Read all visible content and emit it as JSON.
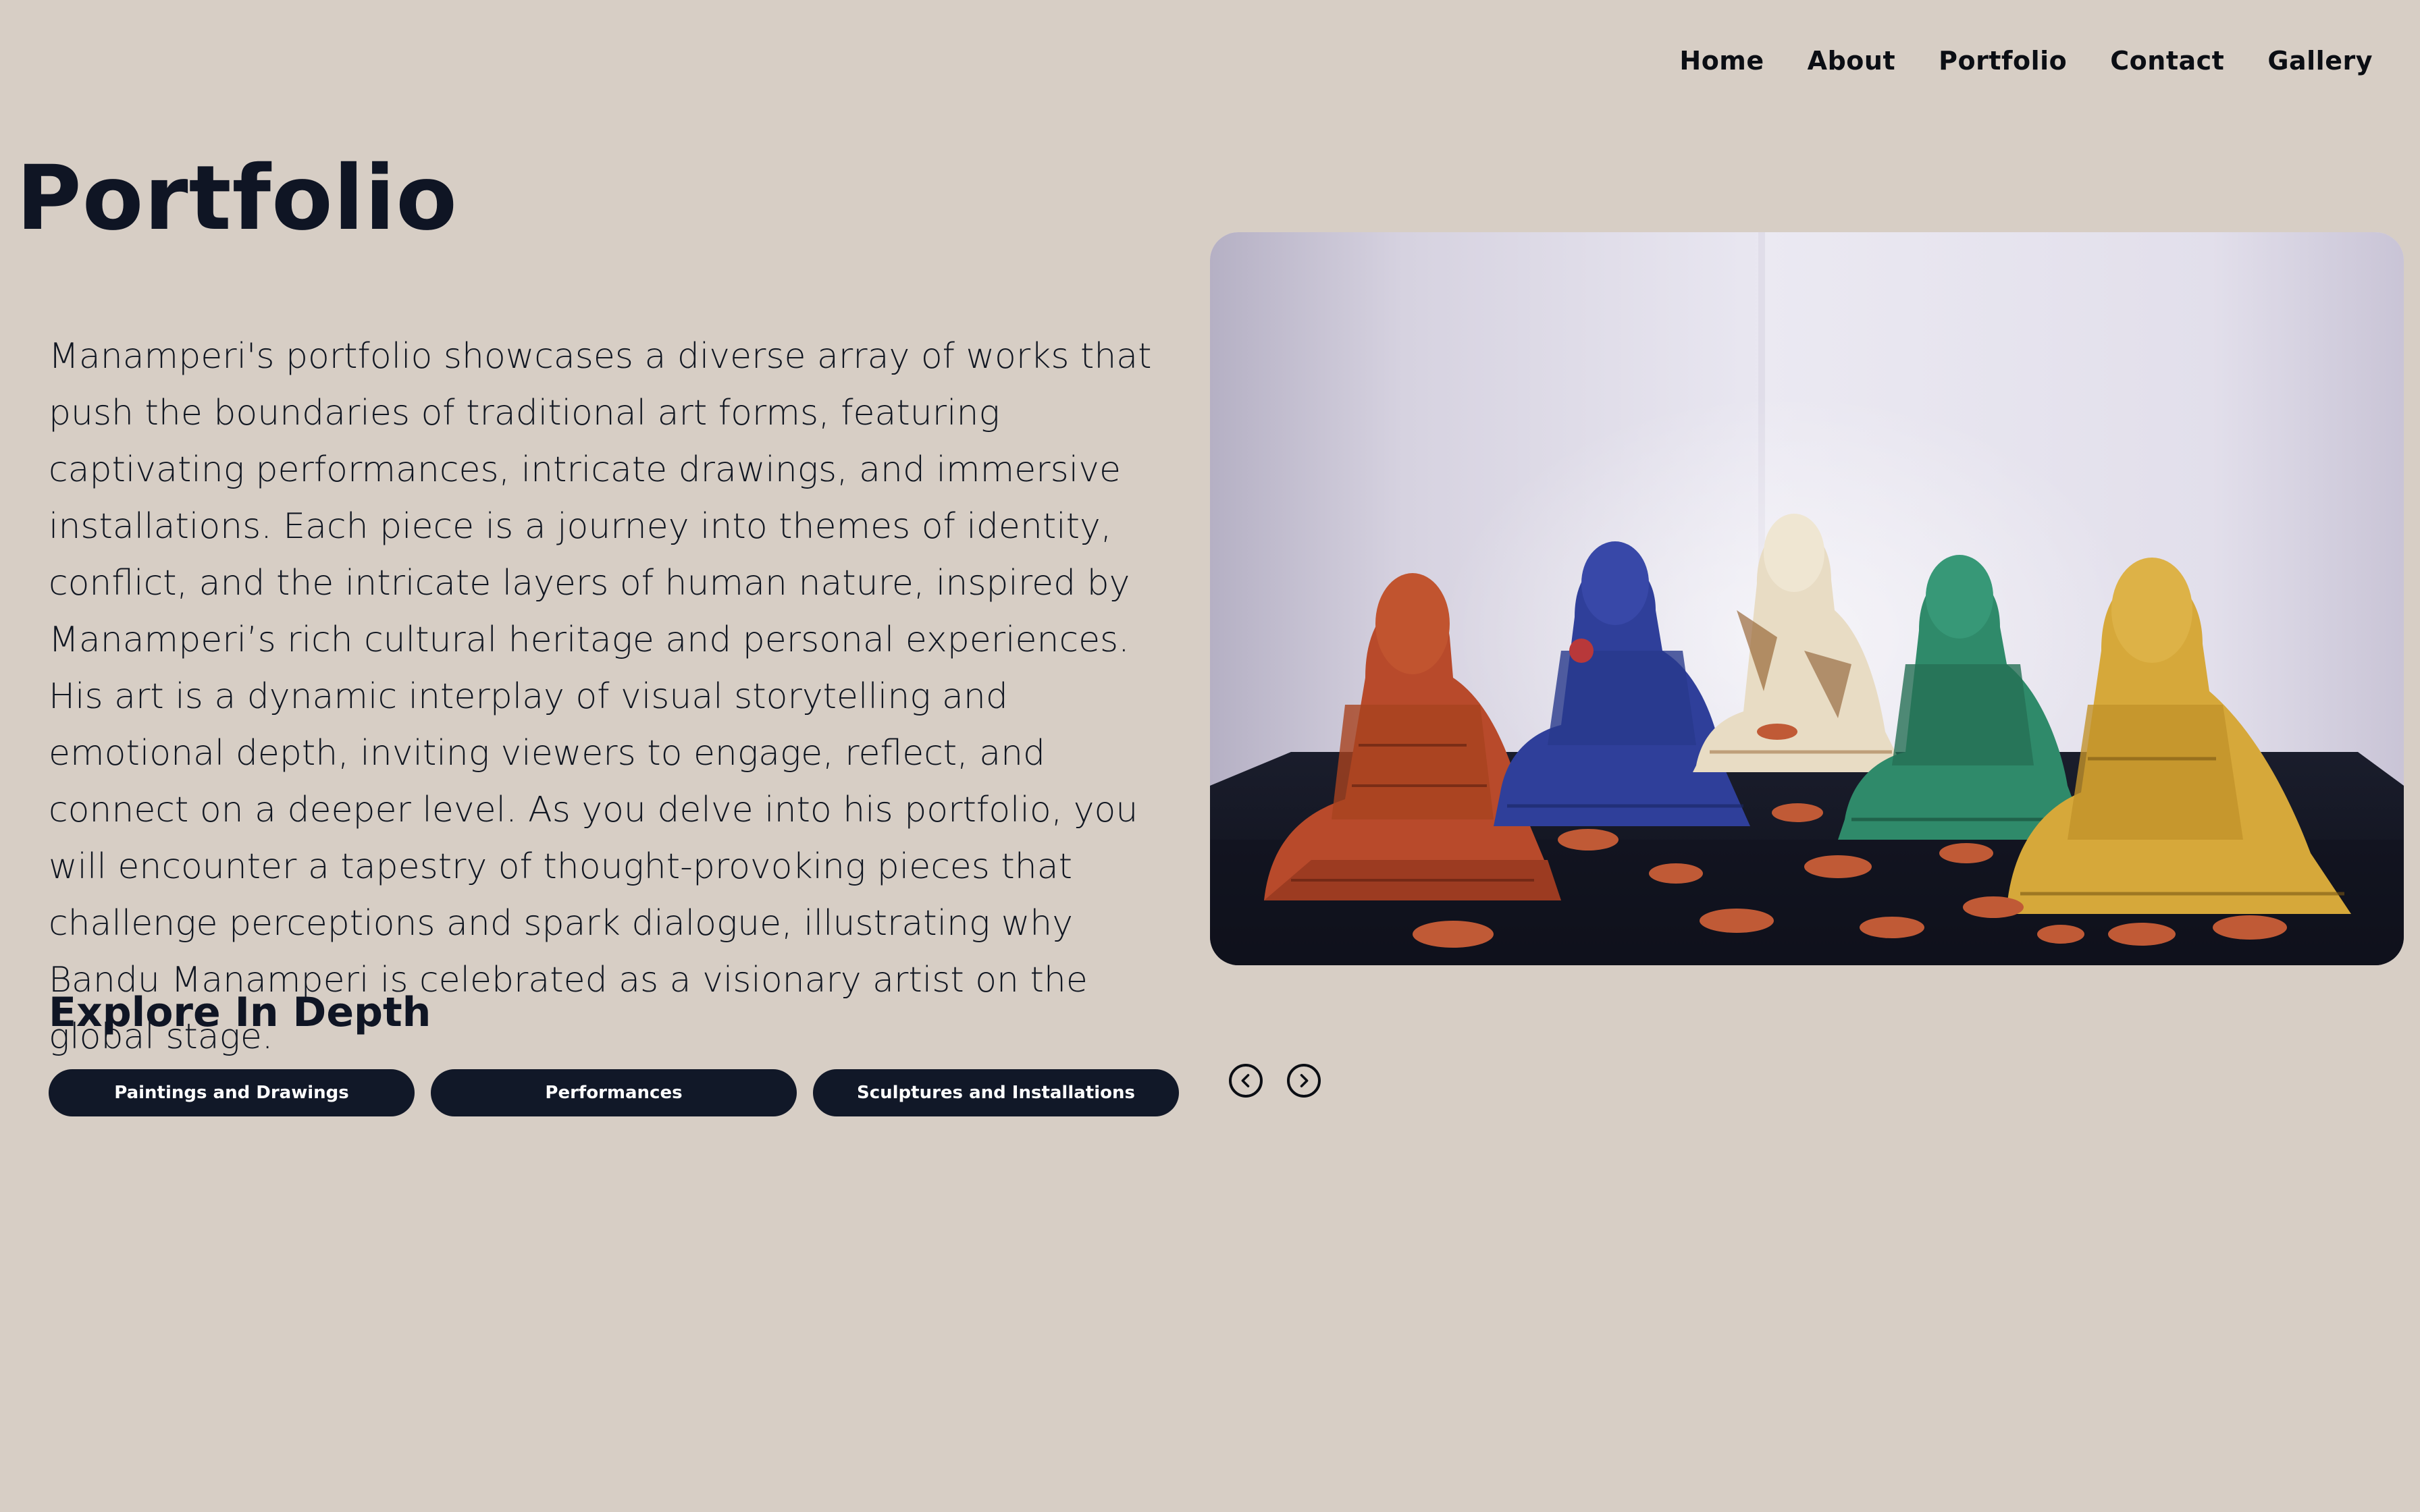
{
  "nav": {
    "items": [
      {
        "label": "Home"
      },
      {
        "label": "About"
      },
      {
        "label": "Portfolio"
      },
      {
        "label": "Contact"
      },
      {
        "label": "Gallery"
      }
    ]
  },
  "page": {
    "title": "Portfolio",
    "description": "Manamperi's portfolio showcases a diverse array of works that push the boundaries of traditional art forms, featuring captivating performances, intricate drawings, and immersive installations. Each piece is a journey into themes of identity, conflict, and the intricate layers of human nature, inspired by Manamperi’s rich cultural heritage and personal experiences. His art is a dynamic interplay of visual storytelling and emotional depth, inviting viewers to engage, reflect, and connect on a deeper level. As you delve into his portfolio, you will encounter a tapestry of thought-provoking pieces that challenge perceptions and spark dialogue, illustrating why Bandu Manamperi is celebrated as a visionary artist on the global stage."
  },
  "explore": {
    "heading": "Explore In Depth",
    "categories": [
      {
        "label": "Paintings and Drawings"
      },
      {
        "label": "Performances"
      },
      {
        "label": "Sculptures and Installations"
      }
    ]
  },
  "carousel": {
    "prev_icon": "chevron-left-circle-icon",
    "next_icon": "chevron-right-circle-icon"
  },
  "colors": {
    "background": "#d7cec5",
    "text": "#0f1524",
    "pill_bg": "#111828",
    "pill_text": "#ffffff"
  }
}
